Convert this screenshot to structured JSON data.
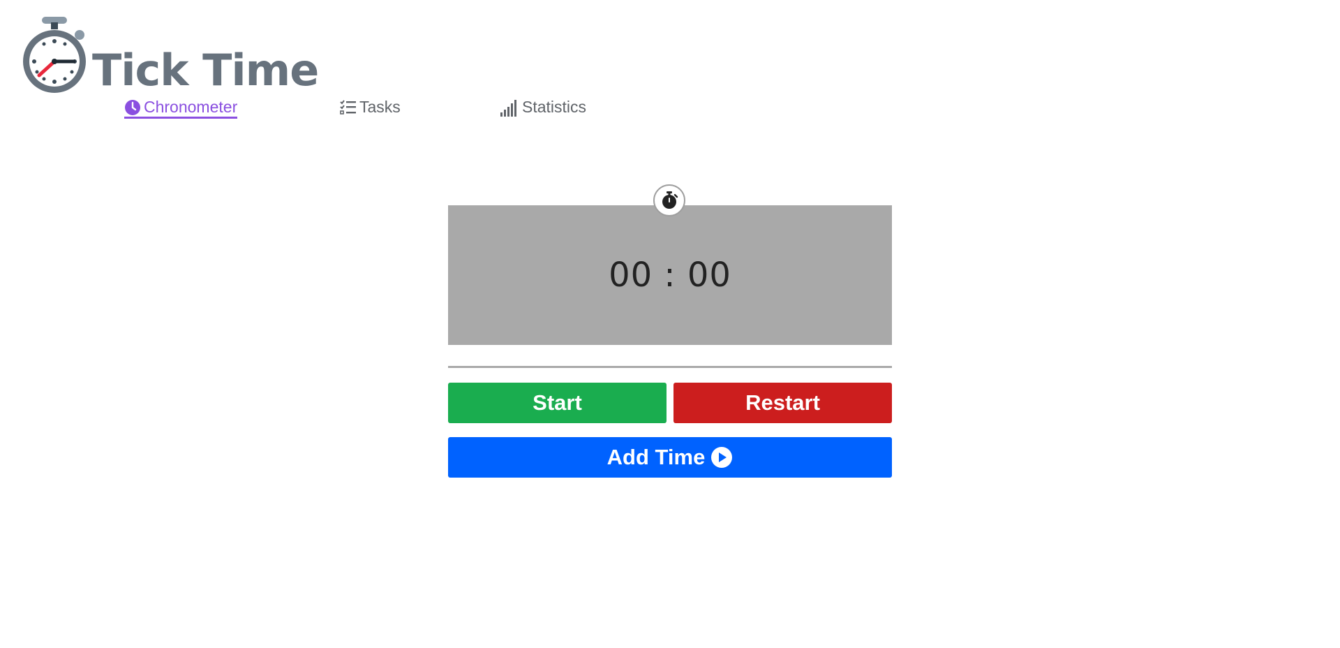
{
  "app": {
    "title": "Tick Time"
  },
  "nav": {
    "items": [
      {
        "label": "Chronometer",
        "icon": "clock-icon",
        "active": true
      },
      {
        "label": "Tasks",
        "icon": "checklist-icon",
        "active": false
      },
      {
        "label": "Statistics",
        "icon": "signal-bars-icon",
        "active": false
      }
    ]
  },
  "timer": {
    "display": "00 : 00",
    "badge_icon": "stopwatch-icon"
  },
  "buttons": {
    "start_label": "Start",
    "restart_label": "Restart",
    "add_time_label": "Add Time"
  },
  "colors": {
    "accent": "#8a4fe0",
    "start": "#1aad4f",
    "restart": "#cc1e1e",
    "add_time": "#0062ff",
    "timer_bg": "#a9a9a9",
    "logo_text": "#67727d"
  }
}
